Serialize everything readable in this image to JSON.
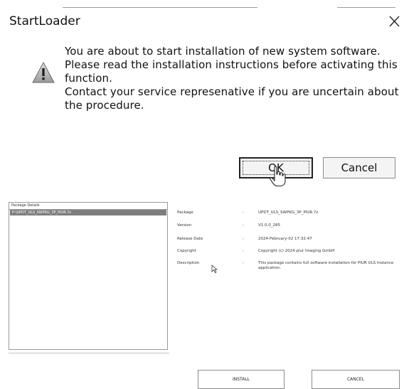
{
  "dialog": {
    "title": "StartLoader",
    "message_lines": [
      "You are about to start installation of new system software.",
      "Please read the installation instructions before activating this",
      "function.",
      "Contact your service represenative if you are uncertain about",
      "the procedure."
    ],
    "ok_label": "OK",
    "cancel_label": "Cancel",
    "icon": "warning-icon"
  },
  "app": {
    "package_header": "Package Details",
    "package_selected": "P:\\UPDT_ULS_SWPKG_3P_PIUR.7z",
    "details": [
      {
        "label": "Package",
        "value": "UPDT_ULS_SWPKG_3P_PIUR.7z"
      },
      {
        "label": "Version",
        "value": "V1.0.0_285"
      },
      {
        "label": "Release Date",
        "value": "2024-February-02 17:32:47"
      },
      {
        "label": "Copyright",
        "value": "Copyright (c) 2024 piur Imaging GmbH"
      },
      {
        "label": "Description",
        "value": "This package contains full software installation for PIUR ULS Instance application."
      }
    ],
    "install_label": "INSTALL",
    "cancel_label": "CANCEL"
  }
}
